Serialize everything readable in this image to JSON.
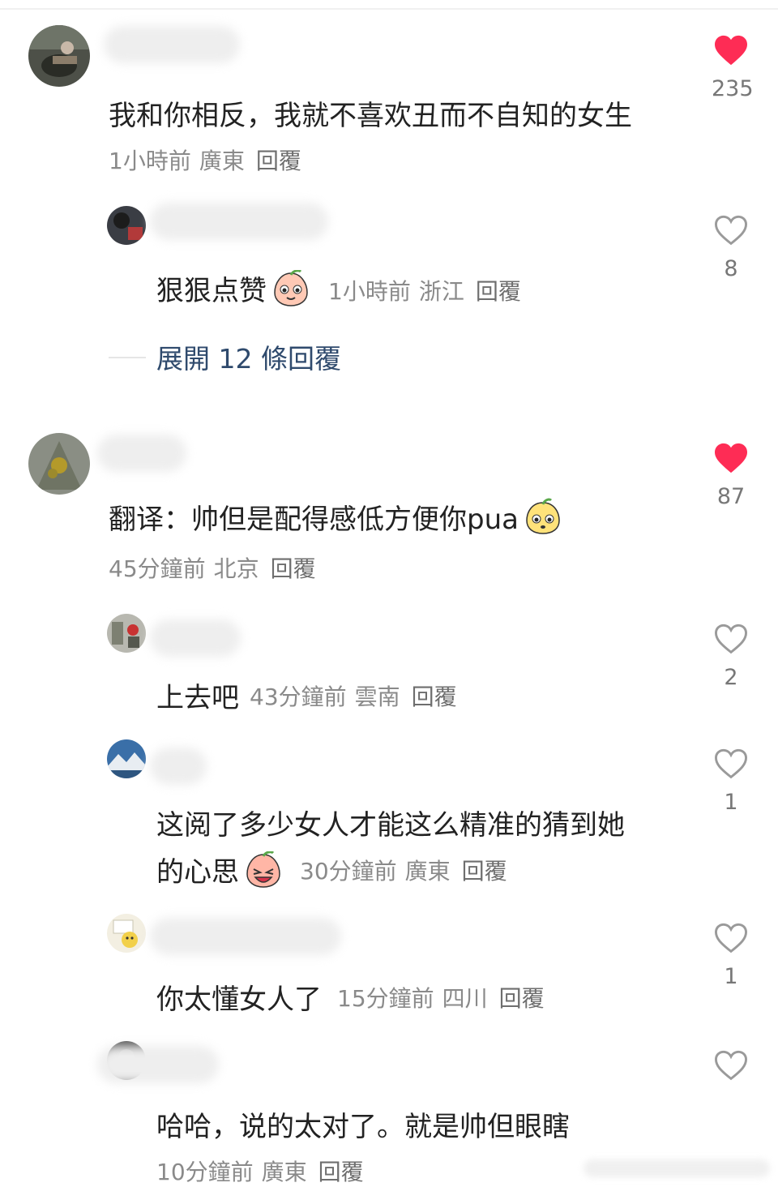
{
  "comments": [
    {
      "text": "我和你相反，我就不喜欢丑而不自知的女生",
      "time": "1小時前",
      "location": "廣東",
      "reply_label": "回覆",
      "likes": "235",
      "liked": true
    },
    {
      "text": "狠狠点赞",
      "time": "1小時前",
      "location": "浙江",
      "reply_label": "回覆",
      "likes": "8",
      "liked": false,
      "emoji": "peach-smile-emoji"
    },
    {
      "expand_label": "展開 12 條回覆"
    },
    {
      "text": "翻译：帅但是配得感低方便你pua",
      "time": "45分鐘前",
      "location": "北京",
      "reply_label": "回覆",
      "likes": "87",
      "liked": true,
      "emoji": "yellow-face-emoji"
    },
    {
      "text": "上去吧",
      "time": "43分鐘前",
      "location": "雲南",
      "reply_label": "回覆",
      "likes": "2",
      "liked": false
    },
    {
      "text_line1": "这阅了多少女人才能这么精准的猜到她",
      "text_line2": "的心思",
      "time": "30分鐘前",
      "location": "廣東",
      "reply_label": "回覆",
      "likes": "1",
      "liked": false,
      "emoji": "peach-laugh-emoji"
    },
    {
      "text": "你太懂女人了",
      "time": "15分鐘前",
      "location": "四川",
      "reply_label": "回覆",
      "likes": "1",
      "liked": false
    },
    {
      "text": "哈哈，说的太对了。就是帅但眼瞎",
      "time": "10分鐘前",
      "location": "廣東",
      "reply_label": "回覆",
      "likes": "",
      "liked": false
    }
  ],
  "colors": {
    "liked_heart": "#fe2c55",
    "outline_heart": "#9a9a9a",
    "expand_link": "#2f4a6d"
  }
}
